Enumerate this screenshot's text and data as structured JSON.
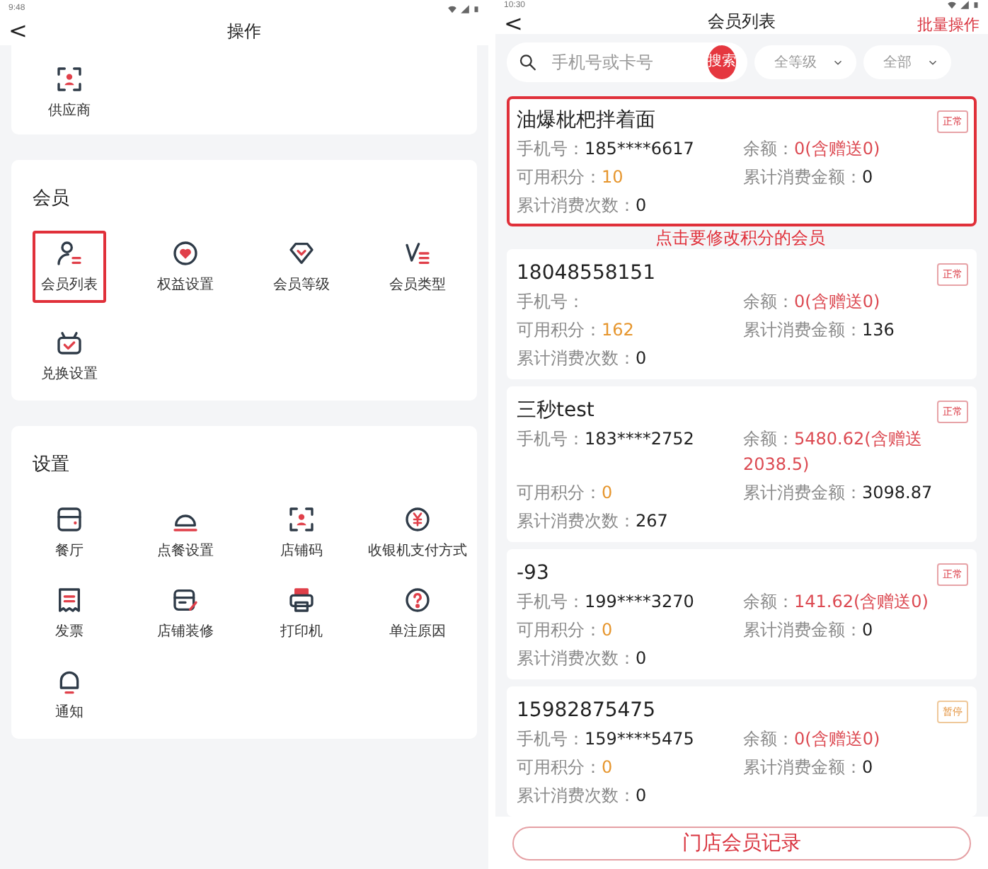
{
  "left_screen": {
    "status_bar": {
      "time": "9:48"
    },
    "header": {
      "back": "<",
      "title": "操作"
    },
    "sections": [
      {
        "items": [
          {
            "label": "供应商",
            "highlighted": false
          }
        ]
      },
      {
        "title": "会员",
        "items": [
          {
            "label": "会员列表",
            "highlighted": true
          },
          {
            "label": "权益设置",
            "highlighted": false
          },
          {
            "label": "会员等级",
            "highlighted": false
          },
          {
            "label": "会员类型",
            "highlighted": false
          },
          {
            "label": "兑换设置",
            "highlighted": false
          }
        ]
      },
      {
        "title": "设置",
        "items": [
          {
            "label": "餐厅",
            "highlighted": false
          },
          {
            "label": "点餐设置",
            "highlighted": false
          },
          {
            "label": "店铺码",
            "highlighted": false
          },
          {
            "label": "收银机支付方式",
            "highlighted": false
          },
          {
            "label": "发票",
            "highlighted": false
          },
          {
            "label": "店铺装修",
            "highlighted": false
          },
          {
            "label": "打印机",
            "highlighted": false
          },
          {
            "label": "单注原因",
            "highlighted": false
          },
          {
            "label": "通知",
            "highlighted": false
          }
        ]
      }
    ]
  },
  "right_screen": {
    "status_bar": {
      "time": "10:30"
    },
    "header": {
      "back": "<",
      "title": "会员列表",
      "action": "批量操作"
    },
    "search": {
      "placeholder": "手机号或卡号",
      "button": "搜索"
    },
    "filters": [
      {
        "label": "全等级"
      },
      {
        "label": "全部"
      }
    ],
    "annotation": "点击要修改积分的会员",
    "members": [
      {
        "name": "油爆枇杷拌着面",
        "status": "正常",
        "kind": "normal",
        "highlighted": true,
        "phone": {
          "label": "手机号：",
          "value": "185****6617"
        },
        "balance": {
          "label": "余额：",
          "value": "0(含赠送0)"
        },
        "points": {
          "label": "可用积分：",
          "value": "10"
        },
        "total_spent": {
          "label": "累计消费金额：",
          "value": "0"
        },
        "visits": {
          "label": "累计消费次数：",
          "value": "0"
        }
      },
      {
        "name": "18048558151",
        "status": "正常",
        "kind": "normal",
        "highlighted": false,
        "phone": {
          "label": "手机号："
        },
        "balance": {
          "label": "余额：",
          "value": "0(含赠送0)"
        },
        "points": {
          "label": "可用积分：",
          "value": "162"
        },
        "total_spent": {
          "label": "累计消费金额：",
          "value": "136"
        },
        "visits": {
          "label": "累计消费次数：",
          "value": "0"
        }
      },
      {
        "name": "三秒test",
        "status": "正常",
        "kind": "normal",
        "highlighted": false,
        "phone": {
          "label": "手机号：",
          "value": "183****2752"
        },
        "balance": {
          "label": "余额：",
          "value": "5480.62(含赠送2038.5)"
        },
        "points": {
          "label": "可用积分：",
          "value": "0"
        },
        "total_spent": {
          "label": "累计消费金额：",
          "value": "3098.87"
        },
        "visits": {
          "label": "累计消费次数：",
          "value": "267"
        }
      },
      {
        "name": "-93",
        "status": "正常",
        "kind": "normal",
        "highlighted": false,
        "phone": {
          "label": "手机号：",
          "value": "199****3270"
        },
        "balance": {
          "label": "余额：",
          "value": "141.62(含赠送0)"
        },
        "points": {
          "label": "可用积分：",
          "value": "0"
        },
        "total_spent": {
          "label": "累计消费金额：",
          "value": "0"
        },
        "visits": {
          "label": "累计消费次数：",
          "value": "0"
        }
      },
      {
        "name": "15982875475",
        "status": "暂停",
        "kind": "paused",
        "highlighted": false,
        "phone": {
          "label": "手机号：",
          "value": "159****5475"
        },
        "balance": {
          "label": "余额：",
          "value": "0(含赠送0)"
        },
        "points": {
          "label": "可用积分：",
          "value": "0"
        },
        "total_spent": {
          "label": "累计消费金额：",
          "value": "0"
        },
        "visits": {
          "label": "累计消费次数：",
          "value": "0"
        }
      }
    ],
    "footer_button": "门店会员记录"
  }
}
